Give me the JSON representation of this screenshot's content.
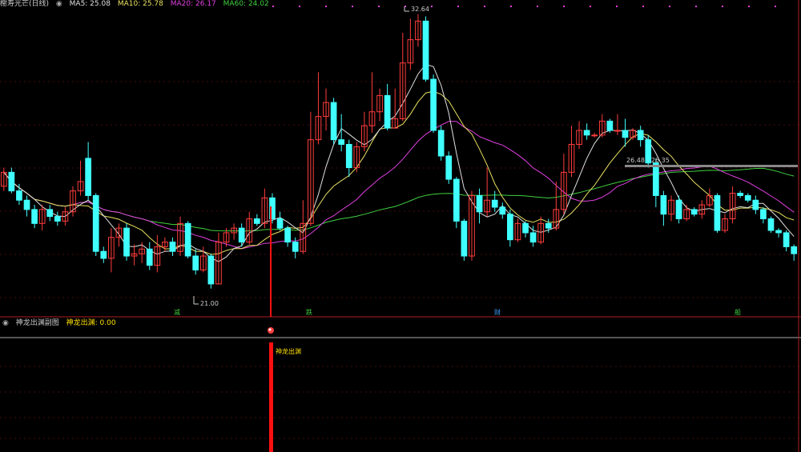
{
  "main_header": {
    "title": "榭寿光芒(日线)",
    "ma_labels": [
      {
        "text": "MA5: 25.08",
        "color": "#e0e0e0"
      },
      {
        "text": "MA10: 25.78",
        "color": "#e8e060"
      },
      {
        "text": "MA20: 26.17",
        "color": "#e040e0"
      },
      {
        "text": "MA60: 24.02",
        "color": "#40d040"
      }
    ]
  },
  "sub_header": {
    "title": "神龙出渊副图",
    "value_label": "神龙出渊: 0.00"
  },
  "annotations": {
    "high": "32.64",
    "low": "21.00",
    "range": "26.48 - 26.35"
  },
  "signal_label": "神龙出渊",
  "markers": [
    {
      "text": "减",
      "color": "#40d040"
    },
    {
      "text": "跌",
      "color": "#40d040"
    },
    {
      "text": "财",
      "color": "#40a0ff"
    },
    {
      "text": "船",
      "color": "#40d040"
    }
  ],
  "colors": {
    "up": "#ff3c3c",
    "down": "#40ffff",
    "ma5": "#e0e0e0",
    "ma10": "#e8e060",
    "ma20": "#e040e0",
    "ma60": "#40d040",
    "signal": "#ff1010",
    "grid": "#8b1a1a"
  },
  "chart_data": {
    "type": "candlestick",
    "series": [
      {
        "name": "K",
        "values": [
          [
            25.2,
            25.8,
            26.0,
            25.0
          ],
          [
            25.8,
            25.0,
            26.0,
            24.9
          ],
          [
            25.0,
            24.6,
            25.3,
            24.4
          ],
          [
            24.6,
            24.2,
            24.8,
            23.9
          ],
          [
            24.2,
            23.6,
            24.4,
            23.4
          ],
          [
            23.6,
            24.2,
            24.4,
            23.3
          ],
          [
            24.2,
            23.9,
            24.4,
            23.7
          ],
          [
            23.9,
            23.7,
            24.1,
            23.5
          ],
          [
            23.7,
            24.1,
            24.3,
            23.5
          ],
          [
            24.1,
            25.0,
            25.2,
            23.9
          ],
          [
            25.0,
            25.4,
            26.3,
            24.8
          ],
          [
            26.4,
            24.8,
            27.1,
            24.6
          ],
          [
            24.8,
            22.4,
            24.9,
            22.2
          ],
          [
            22.4,
            22.1,
            22.6,
            21.9
          ],
          [
            22.1,
            23.0,
            23.4,
            21.5
          ],
          [
            23.0,
            23.4,
            23.6,
            22.6
          ],
          [
            23.4,
            22.2,
            23.6,
            22.0
          ],
          [
            22.2,
            22.3,
            22.7,
            21.8
          ],
          [
            22.3,
            22.5,
            22.8,
            21.9
          ],
          [
            22.5,
            21.8,
            22.8,
            21.6
          ],
          [
            21.8,
            22.6,
            23.1,
            21.5
          ],
          [
            22.6,
            22.8,
            23.0,
            22.4
          ],
          [
            22.8,
            22.4,
            23.0,
            22.2
          ],
          [
            22.4,
            23.6,
            23.9,
            22.2
          ],
          [
            23.6,
            22.2,
            23.7,
            22.1
          ],
          [
            22.2,
            21.6,
            22.5,
            21.4
          ],
          [
            21.6,
            22.2,
            22.6,
            21.5
          ],
          [
            22.2,
            21.0,
            22.3,
            20.8
          ],
          [
            21.0,
            22.8,
            23.2,
            21.0
          ],
          [
            22.8,
            23.2,
            23.4,
            22.6
          ],
          [
            23.2,
            23.4,
            23.6,
            22.9
          ],
          [
            23.4,
            22.8,
            23.6,
            22.6
          ],
          [
            22.8,
            23.8,
            24.1,
            22.7
          ],
          [
            23.8,
            23.6,
            24.0,
            23.5
          ],
          [
            23.6,
            24.7,
            25.1,
            23.4
          ],
          [
            24.7,
            23.8,
            24.9,
            23.6
          ],
          [
            23.8,
            23.4,
            24.1,
            23.3
          ],
          [
            23.4,
            22.8,
            23.5,
            22.6
          ],
          [
            22.8,
            22.4,
            23.0,
            22.1
          ],
          [
            22.4,
            23.6,
            24.6,
            22.3
          ],
          [
            23.6,
            27.2,
            28.4,
            23.5
          ],
          [
            27.2,
            28.2,
            30.1,
            27.0
          ],
          [
            28.2,
            28.8,
            29.4,
            27.6
          ],
          [
            28.8,
            27.2,
            29.0,
            27.0
          ],
          [
            27.2,
            27.0,
            28.3,
            26.7
          ],
          [
            27.0,
            26.0,
            27.2,
            25.6
          ],
          [
            26.0,
            26.9,
            27.1,
            25.8
          ],
          [
            26.9,
            27.8,
            28.4,
            26.7
          ],
          [
            27.8,
            28.4,
            30.1,
            27.5
          ],
          [
            28.4,
            29.1,
            29.4,
            28.0
          ],
          [
            29.1,
            27.7,
            29.6,
            27.6
          ],
          [
            27.7,
            28.1,
            29.4,
            27.7
          ],
          [
            28.1,
            30.5,
            31.8,
            28.0
          ],
          [
            30.5,
            31.5,
            32.4,
            30.2
          ],
          [
            31.5,
            32.3,
            32.6,
            31.2
          ],
          [
            32.3,
            29.8,
            32.5,
            29.7
          ],
          [
            29.8,
            27.6,
            30.0,
            27.5
          ],
          [
            27.6,
            26.5,
            27.8,
            26.3
          ],
          [
            26.5,
            25.5,
            26.7,
            25.3
          ],
          [
            25.5,
            23.7,
            25.6,
            23.4
          ],
          [
            23.7,
            22.2,
            23.8,
            22.0
          ],
          [
            22.2,
            24.8,
            25.0,
            22.0
          ],
          [
            24.8,
            24.1,
            25.1,
            23.6
          ],
          [
            24.1,
            24.6,
            26.0,
            23.9
          ],
          [
            24.6,
            24.3,
            25.0,
            24.1
          ],
          [
            24.3,
            24.0,
            24.5,
            23.8
          ],
          [
            24.0,
            22.9,
            24.2,
            22.6
          ],
          [
            22.9,
            23.6,
            23.8,
            22.8
          ],
          [
            23.6,
            23.2,
            23.7,
            23.0
          ],
          [
            23.2,
            22.8,
            23.5,
            22.6
          ],
          [
            22.8,
            23.6,
            23.9,
            22.7
          ],
          [
            23.6,
            23.4,
            23.8,
            23.2
          ],
          [
            23.4,
            24.2,
            25.4,
            23.3
          ],
          [
            24.2,
            25.8,
            26.6,
            24.0
          ],
          [
            25.8,
            27.0,
            27.8,
            25.6
          ],
          [
            27.0,
            27.6,
            28.0,
            26.8
          ],
          [
            27.6,
            27.4,
            27.9,
            27.2
          ],
          [
            27.4,
            27.4,
            27.5,
            27.3
          ],
          [
            27.4,
            28.0,
            28.3,
            27.3
          ],
          [
            28.0,
            27.6,
            28.1,
            27.5
          ],
          [
            27.6,
            27.6,
            28.3,
            27.4
          ],
          [
            27.6,
            27.3,
            28.1,
            26.9
          ],
          [
            27.3,
            27.6,
            27.7,
            27.2
          ],
          [
            27.6,
            27.2,
            27.8,
            26.9
          ],
          [
            27.2,
            26.2,
            27.4,
            26.0
          ],
          [
            26.2,
            24.8,
            26.4,
            24.3
          ],
          [
            24.8,
            24.0,
            25.0,
            23.5
          ],
          [
            24.0,
            24.6,
            24.8,
            23.7
          ],
          [
            24.6,
            23.8,
            24.8,
            23.6
          ],
          [
            23.8,
            24.2,
            24.4,
            23.7
          ],
          [
            24.2,
            24.0,
            24.3,
            23.9
          ],
          [
            24.0,
            24.4,
            24.6,
            23.8
          ],
          [
            24.4,
            24.8,
            25.1,
            24.3
          ],
          [
            24.8,
            23.3,
            24.9,
            23.2
          ],
          [
            23.3,
            23.8,
            24.0,
            23.2
          ],
          [
            23.8,
            24.9,
            25.2,
            23.6
          ],
          [
            24.9,
            24.8,
            25.0,
            24.7
          ],
          [
            24.8,
            24.6,
            24.9,
            24.5
          ],
          [
            24.6,
            24.2,
            24.8,
            24.0
          ],
          [
            24.2,
            23.8,
            24.3,
            23.6
          ],
          [
            23.8,
            23.3,
            23.9,
            23.2
          ],
          [
            23.3,
            23.2,
            23.4,
            23.0
          ],
          [
            23.2,
            22.6,
            23.3,
            22.4
          ],
          [
            22.6,
            22.3,
            22.7,
            22.0
          ]
        ]
      }
    ],
    "indicator": {
      "name": "神龙出渊",
      "values": [
        0,
        0,
        0,
        0
      ]
    },
    "ylim": [
      20.0,
      33.0
    ]
  }
}
